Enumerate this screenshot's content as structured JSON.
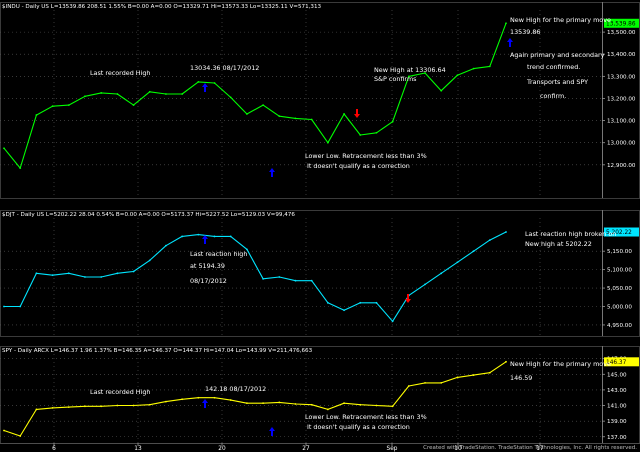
{
  "footer": "Created with TradeStation. TradeStation Technologies, Inc. All rights reserved.",
  "x_axis": {
    "ticks": [
      "6",
      "13",
      "20",
      "27",
      "Sep",
      "10",
      "17"
    ]
  },
  "chart_data": [
    {
      "type": "line",
      "header": "$INDU - Daily US  L=13539.86  208.51  1.55%  B=0.00  A=0.00  O=13329.71  Hi=13573.33  Lo=13325.11  V=571,313",
      "color": "#00ff00",
      "ylim": [
        12750,
        13600
      ],
      "yticks": [
        "13,500.00",
        "13,400.00",
        "13,300.00",
        "13,200.00",
        "13,100.00",
        "13,000.00",
        "12,900.00"
      ],
      "ytick_values": [
        13500,
        13400,
        13300,
        13200,
        13100,
        13000,
        12900
      ],
      "last_label": "13,539.86",
      "series": [
        {
          "values": [
            12975,
            12885,
            13125,
            13165,
            13170,
            13210,
            13225,
            13220,
            13170,
            13230,
            13220,
            13220,
            13275,
            13270,
            13205,
            13130,
            13170,
            13120,
            13110,
            13105,
            13000,
            13130,
            13035,
            13045,
            13095,
            13300,
            13315,
            13235,
            13305,
            13335,
            13345,
            13540
          ]
        }
      ],
      "annotations": [
        {
          "text": "Last recorded High",
          "dx": 90,
          "dy": 75
        },
        {
          "text": "13034.36 08/17/2012",
          "dx": 190,
          "dy": 70
        },
        {
          "text": "New High at 13306.64",
          "dx": 374,
          "dy": 72
        },
        {
          "text": "S&P confirms",
          "dx": 374,
          "dy": 81
        },
        {
          "text": "Lower Low. Retracement less than 3%",
          "dx": 305,
          "dy": 158
        },
        {
          "text": "It doesn't qualify as a correction",
          "dx": 307,
          "dy": 168
        },
        {
          "text": "New High for the primary move",
          "dx": 510,
          "dy": 22
        },
        {
          "text": "13539.86",
          "dx": 510,
          "dy": 34
        },
        {
          "text": "Again primary and secondary",
          "dx": 510,
          "dy": 57
        },
        {
          "text": "trend confirmed.",
          "dx": 527,
          "dy": 69
        },
        {
          "text": "Transports and SPY",
          "dx": 527,
          "dy": 84
        },
        {
          "text": "confirm.",
          "dx": 540,
          "dy": 98
        }
      ],
      "arrows": [
        {
          "color": "#0000ff",
          "dir": "up",
          "dx": 205,
          "dy": 88
        },
        {
          "color": "#ff0000",
          "dir": "down",
          "dx": 357,
          "dy": 113
        },
        {
          "color": "#0000ff",
          "dir": "up",
          "dx": 272,
          "dy": 173
        },
        {
          "color": "#0000ff",
          "dir": "up",
          "dx": 510,
          "dy": 43
        }
      ]
    },
    {
      "type": "line",
      "header": "$DJT - Daily US  L=5202.22  28.04  0.54%  B=0.00  A=0.00  O=5173.37  Hi=5227.52  Lo=5129.03  V=99,476",
      "color": "#00e5ff",
      "ylim": [
        4920,
        5240
      ],
      "yticks": [
        "5,150.00",
        "5,100.00",
        "5,050.00",
        "5,000.00",
        "4,950.00"
      ],
      "ytick_values": [
        5150,
        5100,
        5050,
        5000,
        4950
      ],
      "last_label": "5,202.22",
      "series": [
        {
          "values": [
            5000,
            5000,
            5090,
            5085,
            5090,
            5080,
            5080,
            5090,
            5095,
            5125,
            5165,
            5190,
            5195,
            5190,
            5190,
            5155,
            5075,
            5080,
            5070,
            5070,
            5010,
            4990,
            5010,
            5010,
            4960,
            5030,
            5060,
            5090,
            5120,
            5150,
            5180,
            5202
          ]
        }
      ],
      "annotations": [
        {
          "text": "Last reaction high",
          "dx": 190,
          "dy": 256
        },
        {
          "text": "at 5194.39",
          "dx": 190,
          "dy": 268
        },
        {
          "text": "08/17/2012",
          "dx": 190,
          "dy": 283
        },
        {
          "text": "Last reaction high broken on",
          "dx": 525,
          "dy": 236
        },
        {
          "text": "New high at 5202.22",
          "dx": 525,
          "dy": 246
        }
      ],
      "arrows": [
        {
          "color": "#0000ff",
          "dir": "up",
          "dx": 205,
          "dy": 240
        },
        {
          "color": "#ff0000",
          "dir": "down",
          "dx": 408,
          "dy": 298
        }
      ]
    },
    {
      "type": "line",
      "header": "SPY - Daily  ARCX  L=146.37  1.96  1.37%  B=146.35  A=146.37  O=144.37  Hi=147.04  Lo=143.99  V=211,476,663",
      "color": "#ffff00",
      "ylim": [
        136.2,
        147.6
      ],
      "yticks": [
        "147.00",
        "145.00",
        "143.00",
        "141.00",
        "139.00",
        "137.00"
      ],
      "ytick_values": [
        147,
        145,
        143,
        141,
        139,
        137
      ],
      "last_label": "146.37",
      "series": [
        {
          "values": [
            137.8,
            137.1,
            140.5,
            140.7,
            140.8,
            140.9,
            140.9,
            141.0,
            141.0,
            141.1,
            141.5,
            141.8,
            142.0,
            142.0,
            141.7,
            141.3,
            141.3,
            141.4,
            141.2,
            141.1,
            140.5,
            141.3,
            141.1,
            141.0,
            140.9,
            143.5,
            143.9,
            143.9,
            144.6,
            144.9,
            145.2,
            146.6
          ]
        }
      ],
      "annotations": [
        {
          "text": "Last recorded High",
          "dx": 90,
          "dy": 394
        },
        {
          "text": "142.18 08/17/2012",
          "dx": 205,
          "dy": 391
        },
        {
          "text": "Lower Low. Retracement less than 3%",
          "dx": 305,
          "dy": 419
        },
        {
          "text": "It doesn't qualify as a correction",
          "dx": 307,
          "dy": 429
        },
        {
          "text": "New High for the primary move",
          "dx": 510,
          "dy": 366
        },
        {
          "text": "146.59",
          "dx": 510,
          "dy": 380
        }
      ],
      "arrows": [
        {
          "color": "#0000ff",
          "dir": "up",
          "dx": 205,
          "dy": 404
        },
        {
          "color": "#0000ff",
          "dir": "up",
          "dx": 272,
          "dy": 432
        }
      ]
    }
  ]
}
